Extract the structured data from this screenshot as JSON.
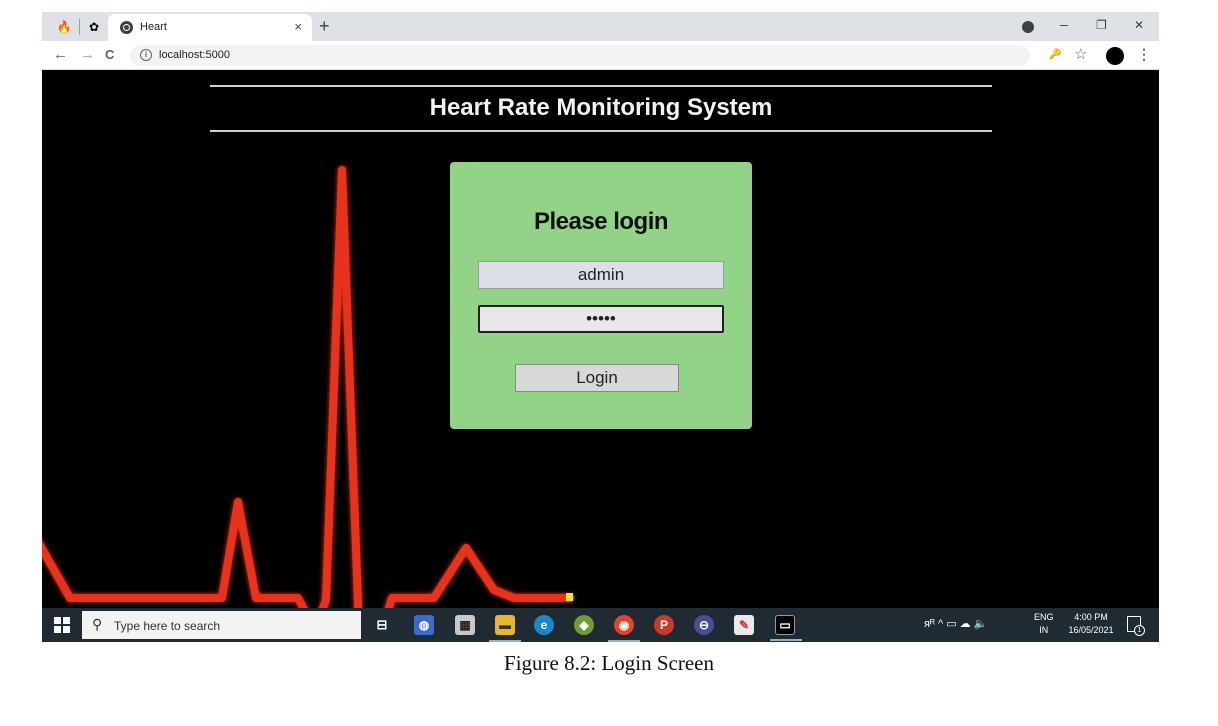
{
  "browser": {
    "tab": {
      "title": "Heart",
      "close_glyph": "×"
    },
    "new_tab_glyph": "+",
    "window_controls": {
      "minimize": "–",
      "restore": "❐",
      "close": "✕"
    },
    "nav": {
      "back": "←",
      "forward": "→",
      "reload": "C"
    },
    "url": "localhost:5000",
    "info_glyph": "i",
    "key_icon": "🔑",
    "star_icon": "☆",
    "menu_glyph": "⋮"
  },
  "page": {
    "title": "Heart Rate Monitoring System",
    "ekg_color": "#e8301e",
    "login": {
      "heading": "Please login",
      "username_value": "admin",
      "password_value": "•••••",
      "button_label": "Login",
      "card_color": "#93d388"
    }
  },
  "taskbar": {
    "search_placeholder": "Type here to search",
    "search_glyph": "⚲",
    "lang_line1": "ENG",
    "lang_line2": "IN",
    "time": "4:00 PM",
    "date": "16/05/2021",
    "notification_count": "1",
    "tray_glyphs": "ᴙᴿ  ^  ▭  ☁  🔈"
  },
  "caption": "Figure 8.2: Login Screen"
}
